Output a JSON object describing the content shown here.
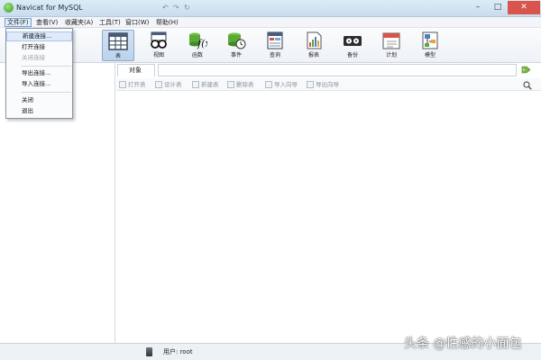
{
  "window": {
    "title": "Navicat for MySQL"
  },
  "menubar": {
    "items": [
      {
        "label": "文件(F)"
      },
      {
        "label": "查看(V)"
      },
      {
        "label": "收藏夹(A)"
      },
      {
        "label": "工具(T)"
      },
      {
        "label": "窗口(W)"
      },
      {
        "label": "帮助(H)"
      }
    ]
  },
  "toolbar": {
    "buttons": [
      {
        "label": "表",
        "icon": "table-icon"
      },
      {
        "label": "视图",
        "icon": "view-icon"
      },
      {
        "label": "函数",
        "icon": "function-icon"
      },
      {
        "label": "事件",
        "icon": "event-icon"
      },
      {
        "label": "查询",
        "icon": "query-icon"
      },
      {
        "label": "报表",
        "icon": "report-icon"
      },
      {
        "label": "备份",
        "icon": "backup-icon"
      },
      {
        "label": "计划",
        "icon": "schedule-icon"
      },
      {
        "label": "模型",
        "icon": "model-icon"
      }
    ],
    "selected": "表"
  },
  "file_menu": {
    "items": [
      {
        "label": "新建连接..."
      },
      {
        "label": "打开连接"
      },
      {
        "label": "关闭连接"
      },
      {
        "label": "导出连接..."
      },
      {
        "label": "导入连接..."
      },
      {
        "label": "关闭"
      },
      {
        "label": "退出"
      }
    ]
  },
  "object_panel": {
    "tab_label": "对象",
    "actions": [
      {
        "label": "打开表"
      },
      {
        "label": "设计表"
      },
      {
        "label": "新建表"
      },
      {
        "label": "删除表"
      },
      {
        "label": "导入向导"
      },
      {
        "label": "导出向导"
      }
    ]
  },
  "status": {
    "user": "用户: root"
  },
  "watermark": "头条 @性感的小面包",
  "colors": {
    "accent": "#6f9fd8",
    "titlebar": "#c9dcee",
    "close_button": "#d9544d"
  }
}
